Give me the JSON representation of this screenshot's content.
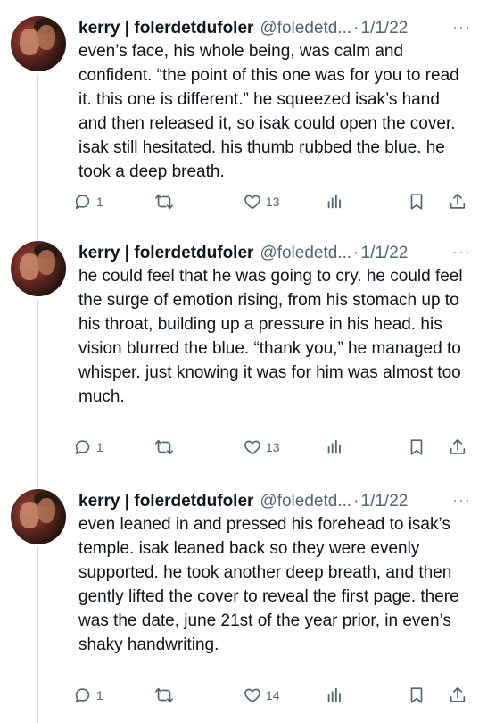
{
  "tweets": [
    {
      "name": "kerry | folerdetdufoler",
      "handle": "@foledetd...",
      "date": "1/1/22",
      "text": "even’s face, his whole being, was calm and confident. “the point of this one was for you to read it. this one is different.” he squeezed isak’s hand and then released it, so isak could open the cover. isak still hesitated. his thumb rubbed the blue. he took a deep breath.",
      "replies": "1",
      "likes": "13"
    },
    {
      "name": "kerry | folerdetdufoler",
      "handle": "@foledetd...",
      "date": "1/1/22",
      "text": "he could feel that he was going to cry. he could feel the surge of emotion rising, from his stomach up to his throat, building up a pressure in his head. his vision blurred the blue. “thank you,” he managed to whisper. just knowing it was for him was almost too much.",
      "replies": "1",
      "likes": "13"
    },
    {
      "name": "kerry | folerdetdufoler",
      "handle": "@foledetd...",
      "date": "1/1/22",
      "text": "even leaned in and pressed his forehead to isak’s temple. isak leaned back so they were evenly supported. he took another deep breath, and then gently lifted the cover to reveal the first page. there was the date, june 21st of the year prior, in even’s shaky handwriting.",
      "replies": "1",
      "likes": "14"
    }
  ],
  "separator": "·",
  "more_glyph": "···",
  "icons": [
    "reply-icon",
    "retweet-icon",
    "like-icon",
    "views-icon",
    "bookmark-icon",
    "share-icon"
  ],
  "colors": {
    "text": "#0f1419",
    "muted": "#536471",
    "thread_line": "#cfd9de"
  }
}
